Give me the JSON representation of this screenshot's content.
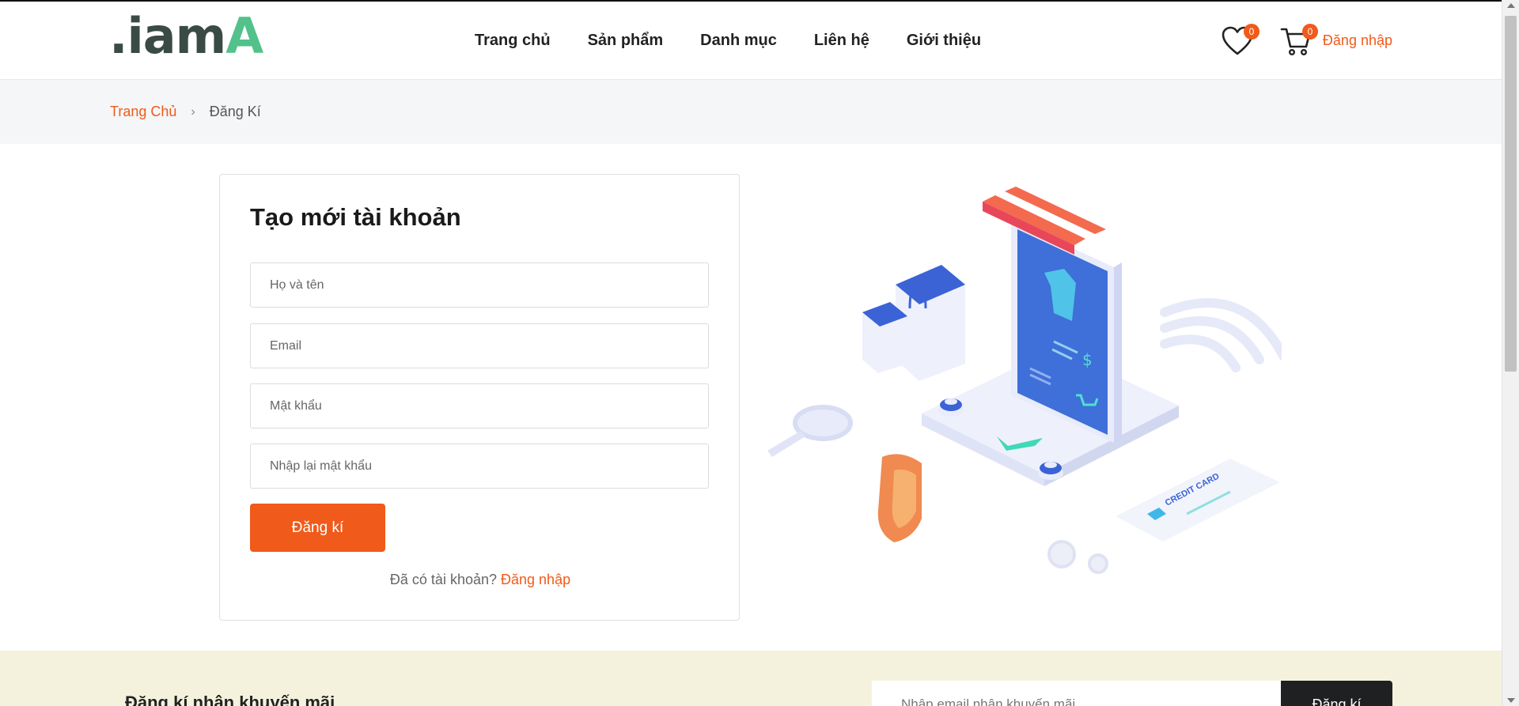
{
  "header": {
    "logo_text": ".iamA",
    "nav": [
      "Trang chủ",
      "Sản phẩm",
      "Danh mục",
      "Liên hệ",
      "Giới thiệu"
    ],
    "wishlist_count": "0",
    "cart_count": "0",
    "login_label": "Đăng nhập",
    "accent_color": "#f05a1a"
  },
  "breadcrumb": {
    "home": "Trang Chủ",
    "separator": "›",
    "current": "Đăng Kí"
  },
  "form": {
    "title": "Tạo mới tài khoản",
    "fullname_placeholder": "Họ và tên",
    "email_placeholder": "Email",
    "password_placeholder": "Mật khẩu",
    "confirm_placeholder": "Nhập lại mật khẩu",
    "submit_label": "Đăng kí",
    "have_account_text": "Đã có tài khoản?",
    "login_link": "Đăng nhập"
  },
  "illustration": {
    "card_label": "CREDIT CARD",
    "price_symbol": "$"
  },
  "newsletter": {
    "title": "Đăng kí nhận khuyến mãi",
    "input_placeholder": "Nhập email nhận khuyến mãi",
    "button_label": "Đăng kí"
  }
}
